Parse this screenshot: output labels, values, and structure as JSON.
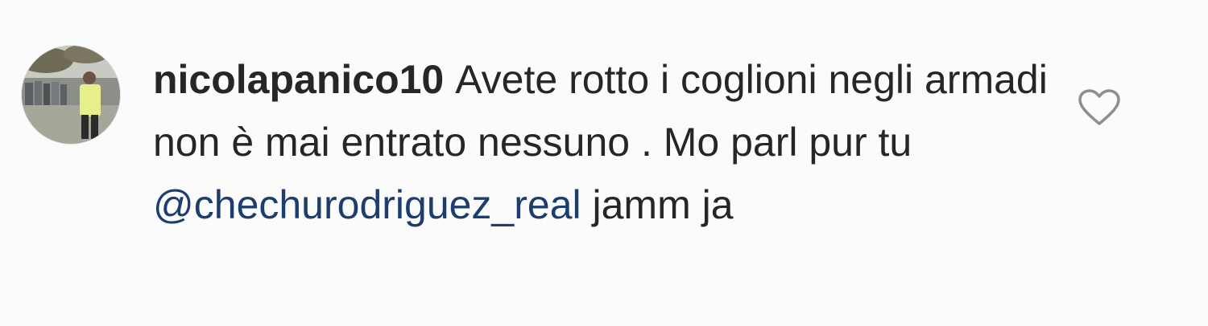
{
  "comment": {
    "username": "nicolapanico10",
    "text": "Avete rotto i coglioni negli armadi non è mai entrato nessuno .  Mo parl pur tu ",
    "mention": "@chechurodriguez_real",
    "text_after": " jamm ja"
  },
  "icons": {
    "like": "heart-outline-icon"
  },
  "colors": {
    "mention": "#1c3d6e",
    "text": "#262626",
    "meta": "#a8a8a8"
  }
}
